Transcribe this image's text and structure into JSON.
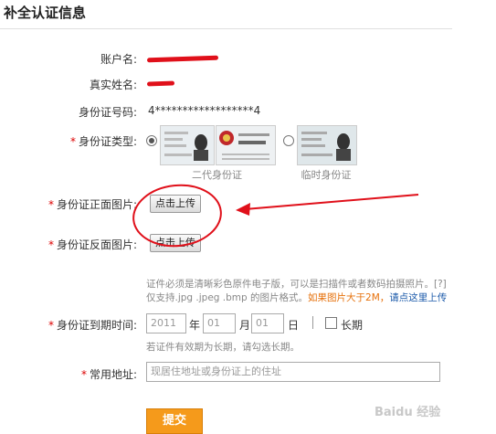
{
  "title": "补全认证信息",
  "labels": {
    "account": "账户名:",
    "realname": "真实姓名:",
    "idnumber": "身份证号码:",
    "idtype": "身份证类型:",
    "front": "身份证正面图片:",
    "back": "身份证反面图片:",
    "expiry": "身份证到期时间:",
    "address": "常用地址:"
  },
  "id_number": "4******************4",
  "id_types": {
    "second_gen": "二代身份证",
    "temporary": "临时身份证",
    "card_text": "中华人民共和国 居民身份证"
  },
  "upload_label": "点击上传",
  "hint": {
    "line1": "证件必须是清晰彩色原件电子版，可以是扫描件或者数码拍摄照片。[?]",
    "line2_a": "仅支持.jpg .jpeg .bmp 的图片格式。",
    "line2_b": "如果图片大于2M，",
    "line2_c": "请点这里上传"
  },
  "expiry": {
    "year": "2011",
    "year_unit": "年",
    "month": "01",
    "month_unit": "月",
    "day": "01",
    "day_unit": "日",
    "long_term": "长期",
    "note": "若证件有效期为长期，请勾选长期。"
  },
  "address_placeholder": "现居住地址或身份证上的住址",
  "submit_label": "提交",
  "watermark": "Baidu 经验",
  "colors": {
    "submit": "#f59a1b",
    "annotation": "#e0101a"
  }
}
